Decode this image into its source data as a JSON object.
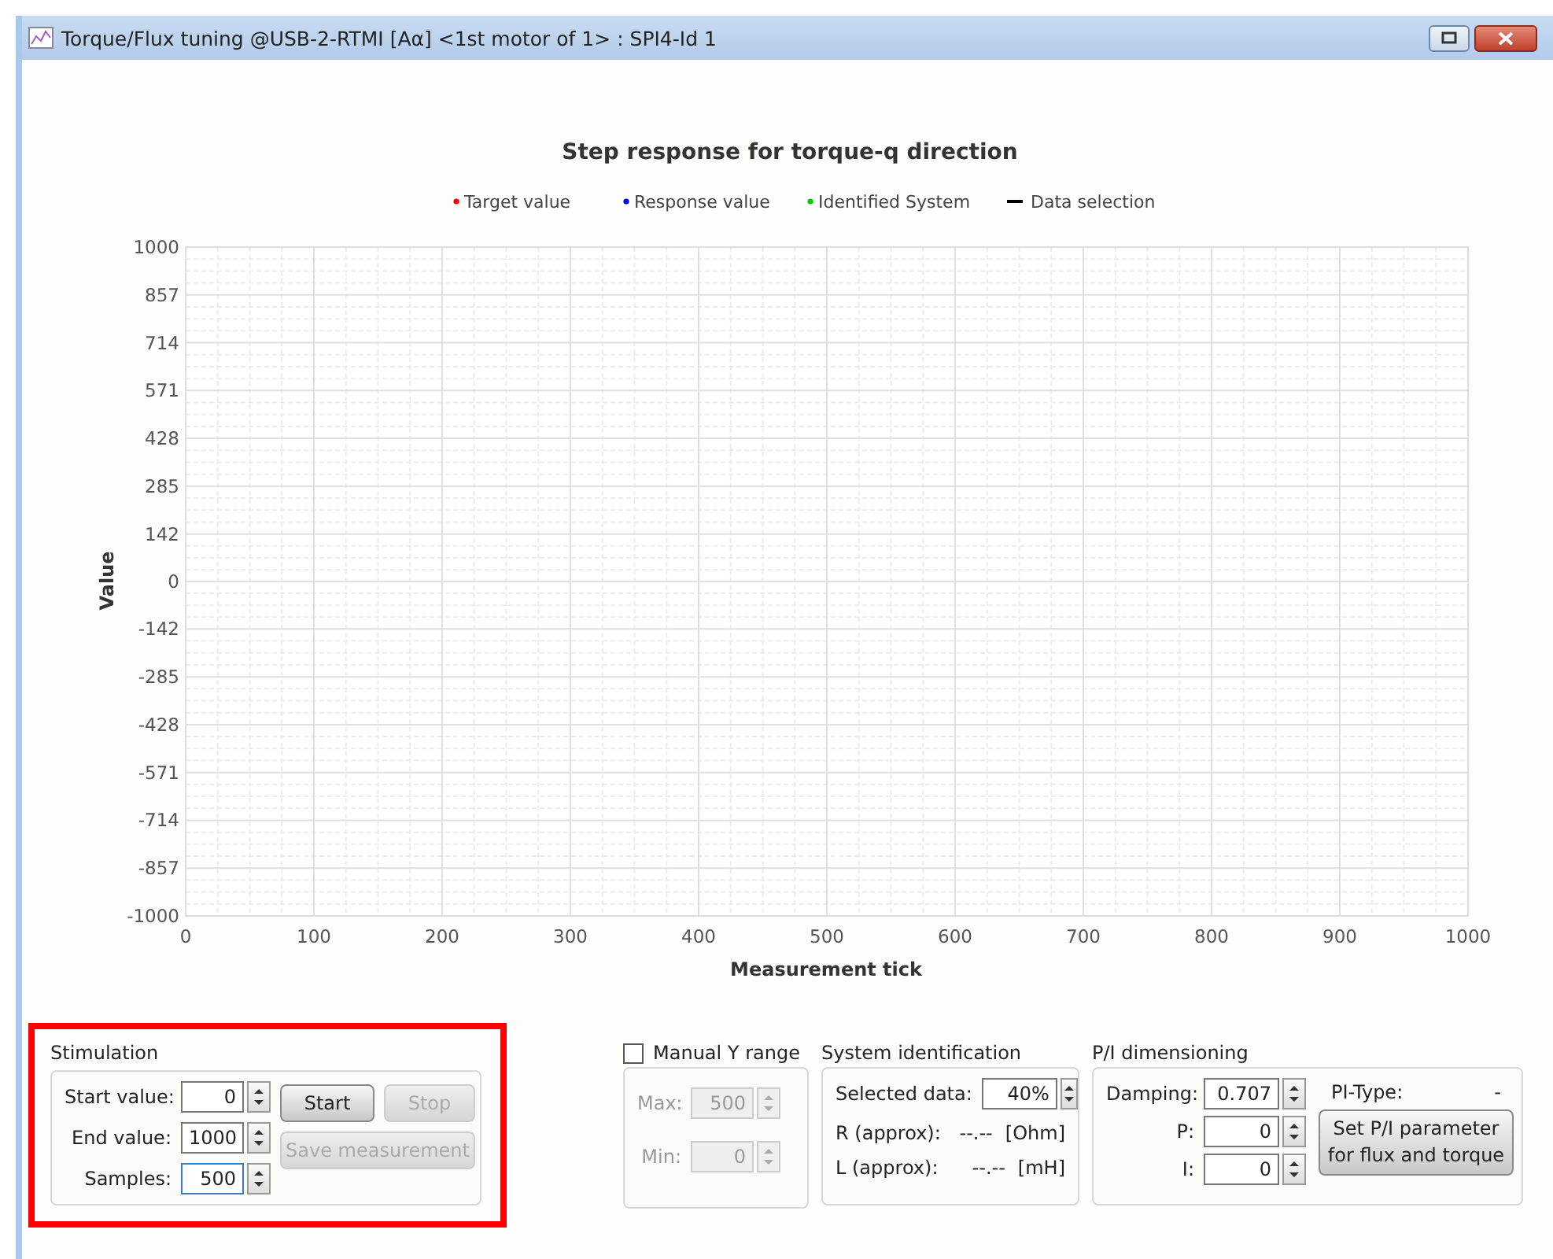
{
  "window": {
    "title": "Torque/Flux tuning @USB-2-RTMI [Aα] <1st motor of 1> : SPI4-Id 1"
  },
  "chart": {
    "legend": [
      {
        "label": "Target value",
        "color": "#ff0000",
        "kind": "dot"
      },
      {
        "label": "Response value",
        "color": "#0000ff",
        "kind": "dot"
      },
      {
        "label": "Identified System",
        "color": "#00cc00",
        "kind": "dot"
      },
      {
        "label": "Data selection",
        "color": "#000000",
        "kind": "line"
      }
    ],
    "chart_data": {
      "type": "line",
      "grid": true,
      "title": "Step response for torque-q direction",
      "xlabel": "Measurement tick",
      "ylabel": "Value",
      "xlim": [
        0,
        1000
      ],
      "ylim": [
        -1000,
        1000
      ],
      "xticks": [
        0,
        100,
        200,
        300,
        400,
        500,
        600,
        700,
        800,
        900,
        1000
      ],
      "yticks": [
        1000,
        857,
        714,
        571,
        428,
        285,
        142,
        0,
        -142,
        -285,
        -428,
        -571,
        -714,
        -857,
        -1000
      ]
    }
  },
  "stimulation": {
    "title": "Stimulation",
    "highlighted": true,
    "fields": [
      {
        "label": "Start value:",
        "value": "0",
        "focused": false
      },
      {
        "label": "End value:",
        "value": "1000",
        "focused": false
      },
      {
        "label": "Samples:",
        "value": "500",
        "focused": true
      }
    ],
    "buttons": [
      {
        "label": "Start",
        "disabled": false
      },
      {
        "label": "Stop",
        "disabled": true
      },
      {
        "label": "Save measurement",
        "disabled": true
      }
    ]
  },
  "y_range": {
    "label": "Manual Y  range",
    "checked": false,
    "fields": [
      {
        "label": "Max:",
        "value": "500",
        "disabled": true
      },
      {
        "label": "Min:",
        "value": "0",
        "disabled": true
      }
    ]
  },
  "system_identification": {
    "title": "System identification",
    "selected_data": {
      "label": "Selected data:",
      "value": "40%"
    },
    "rows": [
      {
        "label": "R (approx):",
        "value": "--.--",
        "unit": "[Ohm]"
      },
      {
        "label": "L (approx):",
        "value": "--.--",
        "unit": "[mH]"
      }
    ]
  },
  "pi": {
    "title": "P/I dimensioning",
    "fields": [
      {
        "label": "Damping:",
        "value": "0.707"
      },
      {
        "label": "P:",
        "value": "0"
      },
      {
        "label": "I:",
        "value": "0"
      }
    ],
    "type_label": "PI-Type:",
    "type_value": "-",
    "button": "Set P/I parameter for flux and torque"
  }
}
